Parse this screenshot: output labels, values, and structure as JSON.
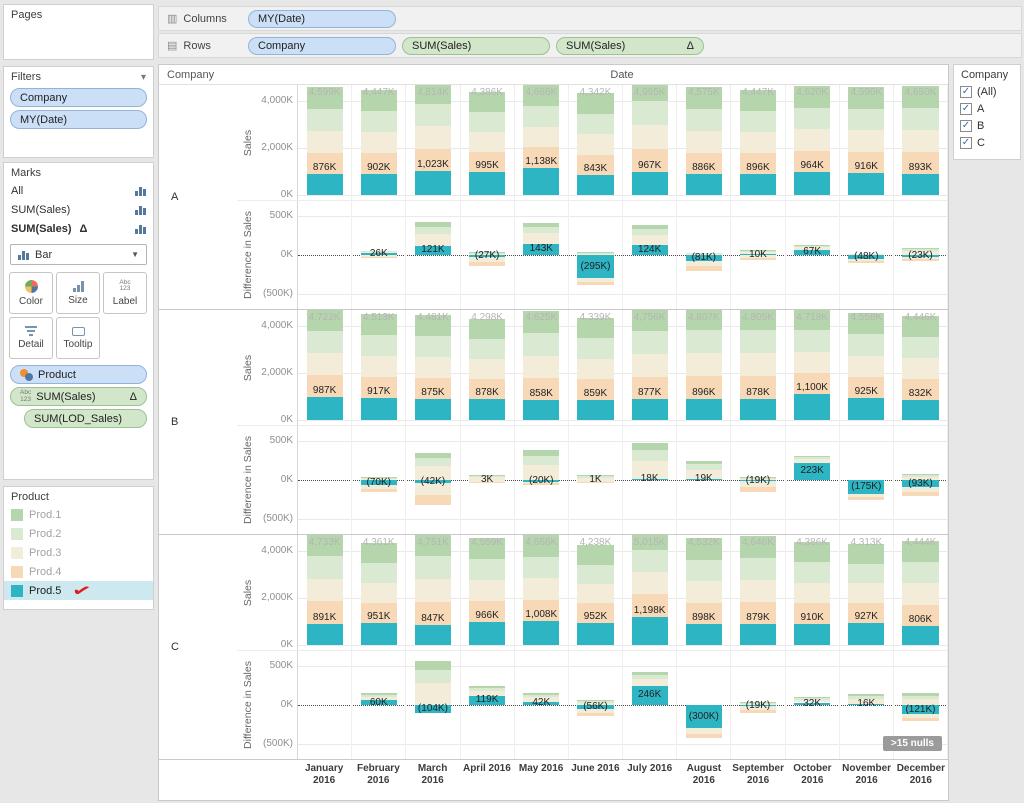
{
  "icons": {
    "columns": "▥",
    "rows": "▤",
    "caret_down": "▾",
    "dropdown_caret": "▼",
    "check": "✓",
    "label_abc": "Abc",
    "label_123": "123"
  },
  "shelves": {
    "columns_label": "Columns",
    "rows_label": "Rows",
    "columns_pills": [
      {
        "label": "MY(Date)",
        "type": "blue"
      }
    ],
    "rows_pills": [
      {
        "label": "Company",
        "type": "blue"
      },
      {
        "label": "SUM(Sales)",
        "type": "green"
      },
      {
        "label": "SUM(Sales)",
        "suffix": "Δ",
        "type": "green"
      }
    ]
  },
  "panels": {
    "pages": {
      "title": "Pages"
    },
    "filters": {
      "title": "Filters",
      "pills": [
        "Company",
        "MY(Date)"
      ]
    },
    "marks": {
      "title": "Marks",
      "rows": [
        {
          "label": "All"
        },
        {
          "label": "SUM(Sales)"
        },
        {
          "label": "SUM(Sales)",
          "suffix": "Δ"
        }
      ],
      "mark_type": "Bar",
      "buttons": {
        "color": "Color",
        "size": "Size",
        "label": "Label",
        "detail": "Detail",
        "tooltip": "Tooltip"
      },
      "pills": [
        {
          "label": "Product"
        },
        {
          "label": "SUM(Sales)",
          "suffix": "Δ"
        },
        {
          "label": "SUM(LOD_Sales)"
        }
      ]
    },
    "product_legend": {
      "title": "Product",
      "annotation_check": "✓",
      "items": [
        {
          "label": "Prod.1",
          "color": "#b5d6ac"
        },
        {
          "label": "Prod.2",
          "color": "#d9e9d2"
        },
        {
          "label": "Prod.3",
          "color": "#f3ecd9"
        },
        {
          "label": "Prod.4",
          "color": "#f7d9b7"
        },
        {
          "label": "Prod.5",
          "color": "#2eb5c4",
          "selected": true
        }
      ]
    },
    "company_legend": {
      "title": "Company",
      "items": [
        "(All)",
        "A",
        "B",
        "C"
      ]
    }
  },
  "chart_data": {
    "type": "bar",
    "row_header": "Company",
    "col_header": "Date",
    "units": "K = thousands of Sales",
    "sales_axis": {
      "label": "Sales",
      "ticks": [
        {
          "v": 4000,
          "label": "4,000K"
        },
        {
          "v": 2000,
          "label": "2,000K"
        },
        {
          "v": 0,
          "label": "0K"
        }
      ]
    },
    "diff_axis": {
      "label": "Difference in Sales",
      "ticks": [
        {
          "v": 500,
          "label": "500K"
        },
        {
          "v": 0,
          "label": "0K"
        },
        {
          "v": -500,
          "label": "(500K)"
        }
      ]
    },
    "months": [
      "January 2016",
      "February 2016",
      "March 2016",
      "April 2016",
      "May 2016",
      "June 2016",
      "July 2016",
      "August 2016",
      "September 2016",
      "October 2016",
      "November 2016",
      "December 2016"
    ],
    "stack_order_bottom_to_top": [
      "Prod.5",
      "Prod.4",
      "Prod.3",
      "Prod.2",
      "Prod.1"
    ],
    "nulls_badge": ">15 nulls",
    "companies": [
      {
        "name": "A",
        "totals": [
          4599,
          4447,
          4814,
          4386,
          4686,
          4342,
          4995,
          4575,
          4447,
          4620,
          4590,
          4650
        ],
        "prod5": [
          876,
          902,
          1023,
          995,
          1138,
          843,
          967,
          886,
          896,
          964,
          916,
          893
        ],
        "diff": [
          null,
          26,
          121,
          -27,
          143,
          -295,
          124,
          -81,
          10,
          67,
          -48,
          -23
        ],
        "diff_other_pos_est": [
          0,
          30,
          300,
          40,
          270,
          40,
          260,
          30,
          60,
          60,
          20,
          90
        ],
        "diff_other_neg_est": [
          0,
          40,
          0,
          110,
          0,
          90,
          0,
          120,
          60,
          0,
          60,
          60
        ]
      },
      {
        "name": "B",
        "totals": [
          4722,
          4513,
          4481,
          4298,
          4625,
          4339,
          4756,
          4807,
          4805,
          4718,
          4558,
          4446
        ],
        "prod5": [
          987,
          917,
          875,
          878,
          858,
          859,
          877,
          896,
          878,
          1100,
          925,
          832
        ],
        "diff": [
          null,
          -70,
          -42,
          3,
          -20,
          1,
          18,
          19,
          -19,
          223,
          -175,
          -93
        ],
        "diff_other_pos_est": [
          0,
          40,
          350,
          60,
          380,
          60,
          460,
          230,
          40,
          90,
          0,
          80
        ],
        "diff_other_neg_est": [
          0,
          90,
          280,
          40,
          40,
          40,
          0,
          0,
          130,
          0,
          80,
          110
        ]
      },
      {
        "name": "C",
        "totals": [
          4733,
          4361,
          4751,
          4559,
          4666,
          4238,
          5015,
          4532,
          4646,
          4386,
          4313,
          4444
        ],
        "prod5": [
          891,
          951,
          847,
          966,
          1008,
          952,
          1198,
          898,
          879,
          910,
          927,
          806
        ],
        "diff": [
          null,
          60,
          -104,
          119,
          42,
          -56,
          246,
          -300,
          -19,
          32,
          16,
          -121
        ],
        "diff_other_pos_est": [
          0,
          90,
          560,
          130,
          110,
          60,
          180,
          0,
          40,
          70,
          130,
          150
        ],
        "diff_other_neg_est": [
          0,
          0,
          0,
          0,
          0,
          90,
          0,
          120,
          90,
          0,
          0,
          80
        ],
        "has_nulls": true
      }
    ]
  }
}
